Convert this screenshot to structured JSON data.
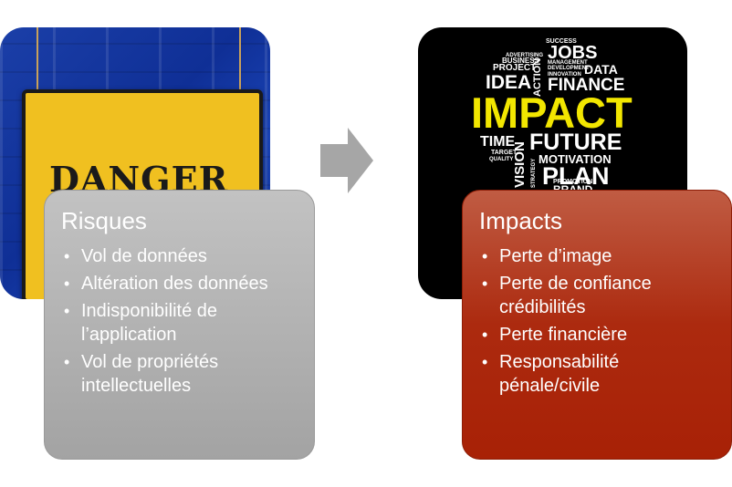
{
  "left_image": {
    "sign_text": "DANGER"
  },
  "right_image": {
    "words": {
      "success": "SUCCESS",
      "jobs": "JOBS",
      "advertising": "ADVERTISING",
      "management": "MANAGEMENT",
      "business": "BUSINESS",
      "development": "DEVELOPMENT",
      "project": "PROJECT",
      "data": "DATA",
      "innovation": "INNOVATION",
      "action": "ACTION",
      "idea": "IDEA",
      "finance": "FINANCE",
      "impact": "IMPACT",
      "time": "TIME",
      "future": "FUTURE",
      "target": "TARGET",
      "quality": "QUALITY",
      "vision": "VISION",
      "motivation": "MOTIVATION",
      "plan": "PLAN",
      "strategy": "STRATEGY",
      "promotion": "PROMOTION",
      "brand": "BRAND"
    }
  },
  "colors": {
    "risks_box": "#a8a8a8",
    "impacts_box": "#b22a0d",
    "arrow": "#a6a6a6",
    "word_yellow": "#f2e600"
  },
  "risks": {
    "title": "Risques",
    "items": [
      "Vol de données",
      "Altération des données",
      "Indisponibilité de l’application",
      "Vol de propriétés intellectuelles"
    ]
  },
  "impacts": {
    "title": "Impacts",
    "items": [
      "Perte d’image",
      "Perte de confiance crédibilités",
      "Perte financière",
      "Responsabilité pénale/civile"
    ]
  }
}
